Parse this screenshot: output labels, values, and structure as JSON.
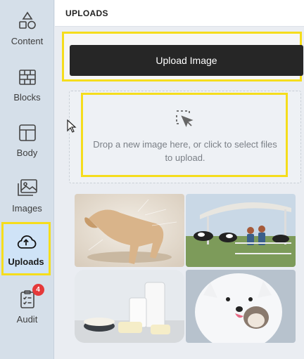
{
  "sidebar": {
    "items": [
      {
        "label": "Content",
        "icon": "shapes-icon"
      },
      {
        "label": "Blocks",
        "icon": "bricks-icon"
      },
      {
        "label": "Body",
        "icon": "layout-icon"
      },
      {
        "label": "Images",
        "icon": "image-gallery-icon"
      },
      {
        "label": "Uploads",
        "icon": "cloud-upload-icon",
        "active": true
      },
      {
        "label": "Audit",
        "icon": "clipboard-check-icon",
        "badge": "4"
      }
    ]
  },
  "header": {
    "title": "UPLOADS"
  },
  "upload": {
    "button_label": "Upload Image"
  },
  "dropzone": {
    "text": "Drop a new image here, or click to select files to upload."
  },
  "colors": {
    "highlight": "#f5dd1c",
    "button_bg": "#262626",
    "badge": "#e5393a",
    "sidebar_bg": "#d5dfe9"
  },
  "thumbnails": [
    {
      "name": "dog-shaking-thumbnail"
    },
    {
      "name": "cows-farm-thumbnail"
    },
    {
      "name": "dairy-products-thumbnail"
    },
    {
      "name": "samoyed-cat-thumbnail"
    }
  ]
}
